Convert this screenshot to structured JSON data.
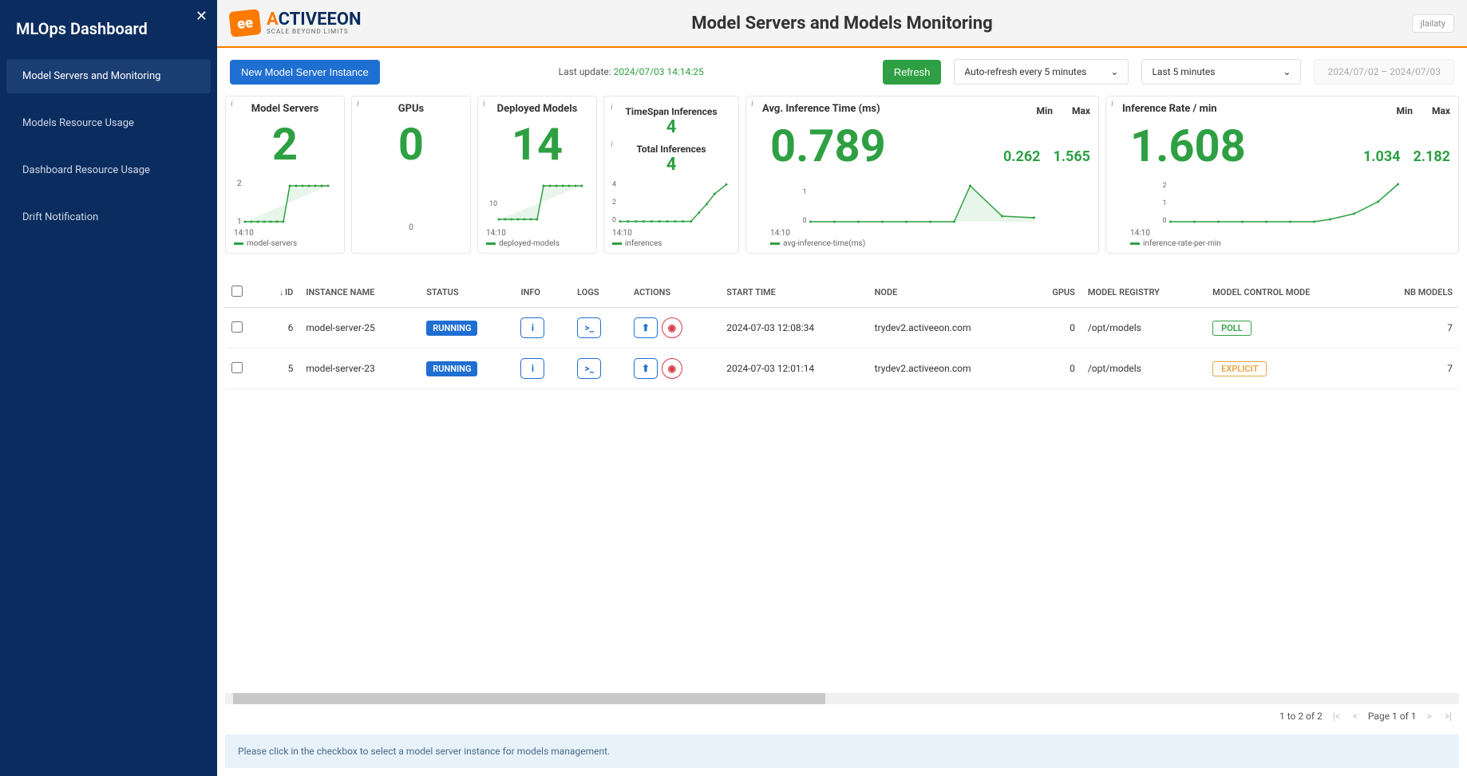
{
  "sidebar": {
    "title": "MLOps Dashboard",
    "items": [
      {
        "label": "Model Servers and Monitoring"
      },
      {
        "label": "Models Resource Usage"
      },
      {
        "label": "Dashboard Resource Usage"
      },
      {
        "label": "Drift Notification"
      }
    ]
  },
  "brand": {
    "logo_glyph": "ee",
    "name_accent": "A",
    "name_rest": "CTIVEEON",
    "subtitle": "SCALE BEYOND LIMITS"
  },
  "header": {
    "title": "Model Servers and Models Monitoring",
    "user": "jlailaty"
  },
  "toolbar": {
    "new_instance": "New Model Server Instance",
    "last_update_label": "Last update:",
    "last_update_ts": "2024/07/03 14:14:25",
    "refresh": "Refresh",
    "autorefresh": "Auto-refresh every 5 minutes",
    "time_window": "Last 5 minutes",
    "date_range": "2024/07/02 – 2024/07/03"
  },
  "cards": {
    "model_servers": {
      "title": "Model Servers",
      "value": "2",
      "y_ticks": [
        "2",
        "1"
      ],
      "x_label": "14:10",
      "legend": "model-servers"
    },
    "gpus": {
      "title": "GPUs",
      "value": "0",
      "spark_label": "0"
    },
    "deployed_models": {
      "title": "Deployed Models",
      "value": "14",
      "y_ticks": [
        "10"
      ],
      "x_label": "14:10",
      "legend": "deployed-models"
    },
    "inferences": {
      "timespan_label": "TimeSpan Inferences",
      "timespan_value": "4",
      "total_label": "Total Inferences",
      "total_value": "4",
      "y_ticks": [
        "4",
        "2",
        "0"
      ],
      "x_label": "14:10",
      "legend": "inferences"
    },
    "avg_inf_time": {
      "title": "Avg. Inference Time (ms)",
      "min_label": "Min",
      "max_label": "Max",
      "value": "0.789",
      "min": "0.262",
      "max": "1.565",
      "y_ticks": [
        "1",
        "0"
      ],
      "x_label": "14:10",
      "legend": "avg-inference-time(ms)"
    },
    "inf_rate": {
      "title": "Inference Rate / min",
      "min_label": "Min",
      "max_label": "Max",
      "value": "1.608",
      "min": "1.034",
      "max": "2.182",
      "y_ticks": [
        "2",
        "1",
        "0"
      ],
      "x_label": "14:10",
      "legend": "inference-rate-per-min"
    }
  },
  "table": {
    "headers": {
      "id": "ID",
      "instance_name": "INSTANCE NAME",
      "status": "STATUS",
      "info": "INFO",
      "logs": "LOGS",
      "actions": "ACTIONS",
      "start_time": "START TIME",
      "node": "NODE",
      "gpus": "GPUS",
      "model_registry": "MODEL REGISTRY",
      "model_control_mode": "MODEL CONTROL MODE",
      "nb_models": "NB MODELS"
    },
    "status_running": "RUNNING",
    "mode_poll": "POLL",
    "mode_explicit": "EXPLICIT",
    "rows": [
      {
        "id": "6",
        "name": "model-server-25",
        "start": "2024-07-03 12:08:34",
        "node": "trydev2.activeeon.com",
        "gpus": "0",
        "registry": "/opt/models",
        "models": "7"
      },
      {
        "id": "5",
        "name": "model-server-23",
        "start": "2024-07-03 12:01:14",
        "node": "trydev2.activeeon.com",
        "gpus": "0",
        "registry": "/opt/models",
        "models": "7"
      }
    ]
  },
  "pager": {
    "range": "1 to 2 of 2",
    "page": "Page 1 of 1"
  },
  "info_hint": "Please click in the checkbox to select a model server instance for models management.",
  "chart_data": [
    {
      "type": "line",
      "title": "model-servers",
      "x_label": "14:10",
      "ylim": [
        1,
        2
      ],
      "series": [
        {
          "name": "model-servers",
          "values": [
            1,
            1,
            1,
            1,
            1,
            1,
            1,
            1,
            2,
            2,
            2,
            2,
            2,
            2
          ]
        }
      ]
    },
    {
      "type": "line",
      "title": "gpus",
      "series": [
        {
          "name": "gpus",
          "values": [
            0
          ]
        }
      ]
    },
    {
      "type": "line",
      "title": "deployed-models",
      "x_label": "14:10",
      "ylim": [
        7,
        14
      ],
      "series": [
        {
          "name": "deployed-models",
          "values": [
            7,
            7,
            7,
            7,
            7,
            7,
            7,
            7,
            14,
            14,
            14,
            14,
            14,
            14
          ]
        }
      ]
    },
    {
      "type": "line",
      "title": "inferences",
      "x_label": "14:10",
      "ylim": [
        0,
        4
      ],
      "series": [
        {
          "name": "inferences",
          "values": [
            0,
            0,
            0,
            0,
            0,
            0,
            0,
            0,
            0,
            0,
            1,
            2,
            3,
            4
          ]
        }
      ]
    },
    {
      "type": "line",
      "title": "avg-inference-time(ms)",
      "x_label": "14:10",
      "ylim": [
        0,
        1.6
      ],
      "series": [
        {
          "name": "avg-inference-time(ms)",
          "values": [
            0,
            0,
            0,
            0,
            0,
            0,
            0,
            0,
            0,
            0,
            0.7,
            1.3,
            0.8,
            0.3
          ]
        }
      ]
    },
    {
      "type": "line",
      "title": "inference-rate-per-min",
      "x_label": "14:10",
      "ylim": [
        0,
        2.2
      ],
      "series": [
        {
          "name": "inference-rate-per-min",
          "values": [
            0,
            0,
            0,
            0,
            0,
            0,
            0,
            0,
            0,
            0,
            0.3,
            0.8,
            1.4,
            2.1
          ]
        }
      ]
    }
  ]
}
